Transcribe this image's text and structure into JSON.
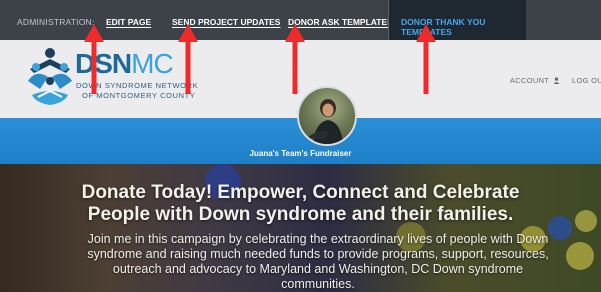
{
  "admin_bar": {
    "label": "ADMINISTRATION:",
    "links": [
      {
        "label": "EDIT PAGE"
      },
      {
        "label": "SEND PROJECT UPDATES"
      },
      {
        "label": "DONOR ASK TEMPLATES"
      },
      {
        "label": "DONOR THANK YOU TEMPLATES",
        "active": true
      }
    ]
  },
  "header": {
    "logo_name_part1": "DSN",
    "logo_name_part2": "MC",
    "logo_tagline_1": "DOWN SYNDROME NETWORK",
    "logo_tagline_2": "OF MONTGOMERY COUNTY",
    "account_label": "ACCOUNT",
    "logout_label": "LOG OU"
  },
  "fundraiser": {
    "name": "Juana's Team's Fundraiser"
  },
  "hero": {
    "title_line1": "Donate Today! Empower, Connect and Celebrate",
    "title_line2": "People with Down syndrome and their families.",
    "body": "Join me in this campaign by celebrating the extraordinary lives of people with Down syndrome and raising much needed funds to provide programs, support, resources, outreach and advocacy to Maryland and Washington, DC Down syndrome communities."
  },
  "colors": {
    "admin_bar": "#3d4148",
    "active_tab_text": "#45a7ee",
    "band_blue": "#2a8fd6",
    "annotation_red": "#ee2a2a"
  },
  "icons": [
    "people-logo-icon",
    "person-icon",
    "red-arrow-annotation"
  ]
}
